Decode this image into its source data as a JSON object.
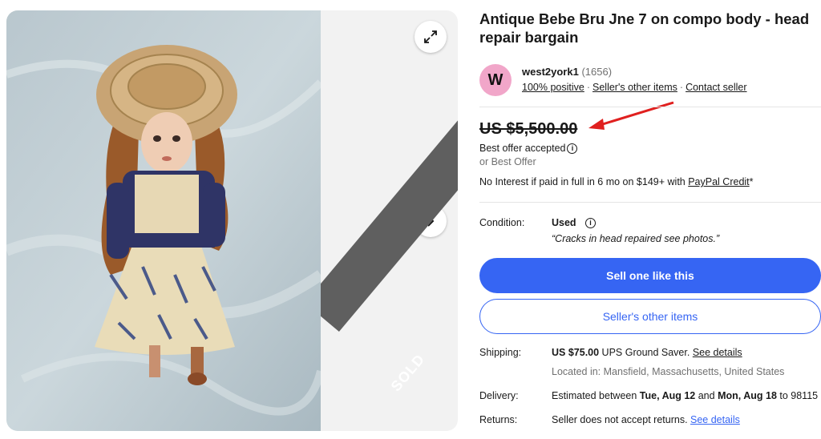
{
  "listing": {
    "title": "Antique Bebe Bru Jne 7 on compo body - head repair bargain",
    "sold_badge": "SOLD"
  },
  "seller": {
    "initial": "W",
    "name": "west2york1",
    "count": "(1656)",
    "positive": "100% positive",
    "other_items_link": "Seller's other items",
    "contact_link": "Contact seller"
  },
  "price": {
    "amount": "US $5,500.00",
    "offer_status": "Best offer accepted",
    "or_best_offer": "or Best Offer",
    "paypal_text": "No Interest if paid in full in 6 mo on $149+ with ",
    "paypal_link": "PayPal Credit",
    "paypal_suffix": "*"
  },
  "condition": {
    "label": "Condition:",
    "value": "Used",
    "note": "“Cracks in head repaired see photos.”"
  },
  "buttons": {
    "sell_like_this": "Sell one like this",
    "seller_other_items": "Seller's other items"
  },
  "shipping": {
    "label": "Shipping:",
    "cost": "US $75.00",
    "service": " UPS Ground Saver. ",
    "details_link": "See details",
    "location": "Located in: Mansfield, Massachusetts, United States"
  },
  "delivery": {
    "label": "Delivery:",
    "prefix": "Estimated between ",
    "start": "Tue, Aug 12",
    "mid": " and ",
    "end": "Mon, Aug 18",
    "suffix": " to 98115"
  },
  "returns": {
    "label": "Returns:",
    "text": "Seller does not accept returns. ",
    "details_link": "See details"
  },
  "colors": {
    "accent": "#3665f3",
    "annotation_arrow": "#e0201f",
    "avatar": "#f1a6c9"
  }
}
